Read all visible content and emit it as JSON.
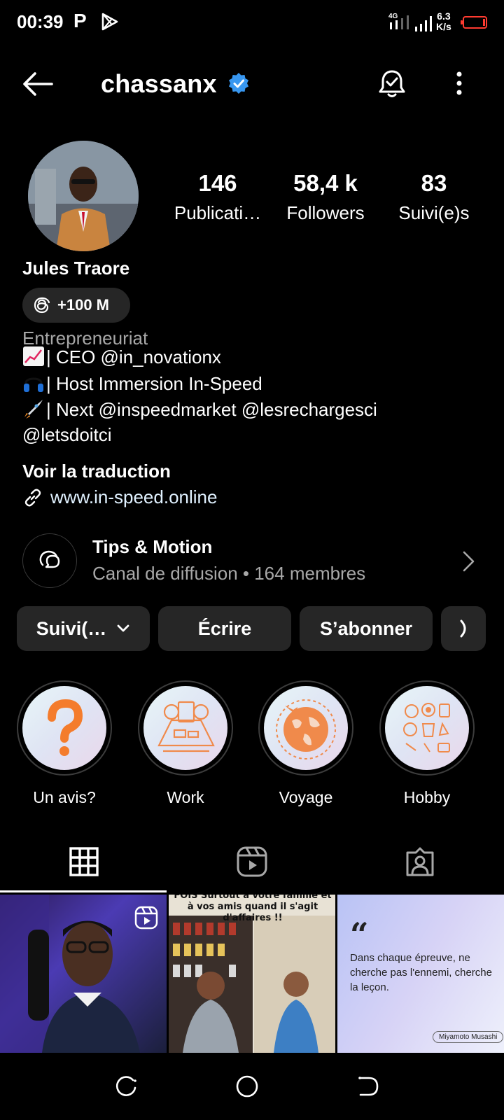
{
  "status_bar": {
    "time": "00:39",
    "p_badge": "P",
    "network": "4G",
    "speed_value": "6.3",
    "speed_unit": "K/s",
    "battery_color": "#ff3b30"
  },
  "header": {
    "username": "chassanx",
    "verified_color": "#3897f0"
  },
  "profile": {
    "stats": [
      {
        "value": "146",
        "label": "Publicati…"
      },
      {
        "value": "58,4 k",
        "label": "Followers"
      },
      {
        "value": "83",
        "label": "Suivi(e)s"
      }
    ],
    "full_name": "Jules Traore",
    "threads_badge": "+100 M",
    "category": "Entrepreneuriat",
    "bio": [
      {
        "icon": "chart-emoji",
        "text": "| CEO @in_novationx"
      },
      {
        "icon": "headphones-emoji",
        "text": "| Host Immersion In-Speed"
      },
      {
        "icon": "rocket-emoji",
        "text": "| Next @inspeedmarket @lesrechargesci"
      },
      {
        "icon": "",
        "text": "@letsdoitci"
      }
    ],
    "translate_label": "Voir la traduction",
    "link": "www.in-speed.online"
  },
  "channel": {
    "title": "Tips & Motion",
    "subtitle": "Canal de diffusion • 164 membres"
  },
  "buttons": {
    "following": "Suivi(…",
    "message": "Écrire",
    "subscribe": "S’abonner"
  },
  "highlights": [
    {
      "label": "Un avis?",
      "icon": "question-mark-icon"
    },
    {
      "label": "Work",
      "icon": "meeting-icon"
    },
    {
      "label": "Voyage",
      "icon": "globe-plane-icon"
    },
    {
      "label": "Hobby",
      "icon": "hobbies-icon"
    }
  ],
  "tabs": [
    {
      "name": "grid",
      "icon": "grid-icon",
      "active": true
    },
    {
      "name": "reels",
      "icon": "reels-icon",
      "active": false
    },
    {
      "name": "tagged",
      "icon": "tagged-icon",
      "active": false
    }
  ],
  "posts": {
    "post2_caption": "FOIS Surtout à votre famille et à vos amis quand il s'agit d'affaires !!",
    "post3_quote": "Dans chaque épreuve, ne cherche pas l'ennemi, cherche la leçon.",
    "post3_author": "Miyamoto Musashi"
  }
}
